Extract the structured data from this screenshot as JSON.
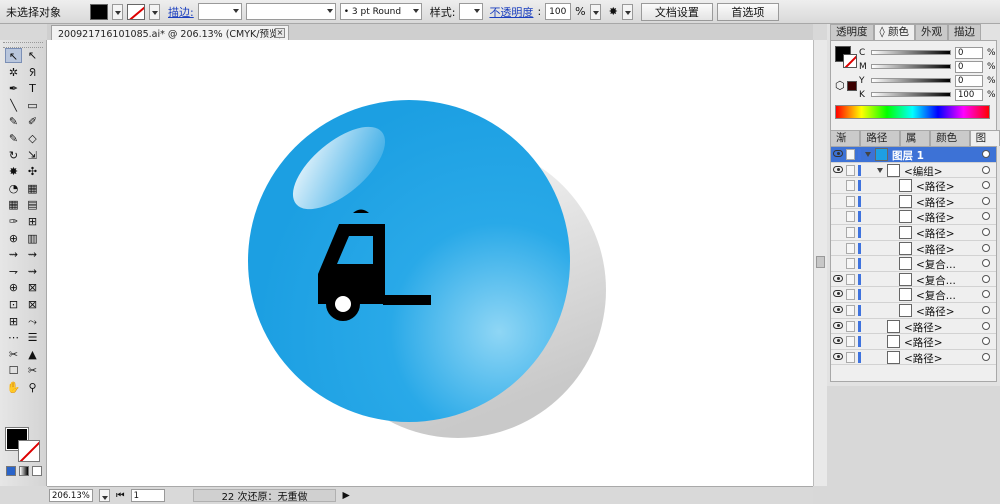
{
  "control_bar": {
    "selection_status": "未选择对象",
    "stroke_link": "描边:",
    "brush_value": "3 pt Round",
    "style_label": "样式:",
    "opacity_link": "不透明度",
    "opacity_value": "100",
    "opacity_unit": "%",
    "doc_setup_button": "文档设置",
    "preferences_button": "首选项"
  },
  "document_tab": {
    "title": "2009217161010​85.ai* @ 206.13% (CMYK/预览)",
    "close_glyph": "×"
  },
  "toolbox": {
    "tool_glyphs": [
      "↖",
      "↖",
      "✲",
      "ᖆ",
      "✒",
      "T",
      "╲",
      "▭",
      "✎",
      "✐",
      "✎",
      "◇",
      "↻",
      "⇲",
      "✸",
      "✣",
      "◔",
      "▦",
      "▦",
      "▤",
      "✑",
      "⊞",
      "⊕",
      "▥",
      "⇝",
      "⇝",
      "⇁",
      "⇝",
      "⊕",
      "⊠",
      "⊡",
      "⊠",
      "⊞",
      "⤳",
      "⋯",
      "☰",
      "✂",
      "▲",
      "☐",
      "✂",
      "✋",
      "⚲"
    ]
  },
  "color_panel": {
    "tabs": [
      "透明度",
      "◊ 颜色",
      "外观",
      "描边"
    ],
    "active_tab": 1,
    "channels": [
      {
        "label": "C",
        "value": "0"
      },
      {
        "label": "M",
        "value": "0"
      },
      {
        "label": "Y",
        "value": "0"
      },
      {
        "label": "K",
        "value": "100"
      }
    ],
    "fill_color": "#000000"
  },
  "layers_panel": {
    "tabs": [
      "渐变",
      "路径查",
      "属性",
      "颜色参",
      "图层"
    ],
    "active_tab": 4,
    "rows": [
      {
        "name": "图层 1",
        "indent": 0,
        "selected": true,
        "eye": true
      },
      {
        "name": "<编组>",
        "indent": 1,
        "selected": false,
        "eye": true
      },
      {
        "name": "<路径>",
        "indent": 2,
        "selected": false,
        "eye": false
      },
      {
        "name": "<路径>",
        "indent": 2,
        "selected": false,
        "eye": false
      },
      {
        "name": "<路径>",
        "indent": 2,
        "selected": false,
        "eye": false
      },
      {
        "name": "<路径>",
        "indent": 2,
        "selected": false,
        "eye": false
      },
      {
        "name": "<路径>",
        "indent": 2,
        "selected": false,
        "eye": false
      },
      {
        "name": "<复合...",
        "indent": 2,
        "selected": false,
        "eye": false
      },
      {
        "name": "<复合...",
        "indent": 2,
        "selected": false,
        "eye": true
      },
      {
        "name": "<复合...",
        "indent": 2,
        "selected": false,
        "eye": true
      },
      {
        "name": "<路径>",
        "indent": 2,
        "selected": false,
        "eye": true
      },
      {
        "name": "<路径>",
        "indent": 1,
        "selected": false,
        "eye": true
      },
      {
        "name": "<路径>",
        "indent": 1,
        "selected": false,
        "eye": true
      },
      {
        "name": "<路径>",
        "indent": 1,
        "selected": false,
        "eye": true
      }
    ]
  },
  "status_bar": {
    "zoom": "206.13%",
    "artboard": "1",
    "undo_status": "22 次还原：无重做"
  },
  "colors": {
    "ball_light": "#8fd6f5",
    "ball_mid": "#29a9e8",
    "ball_dark": "#1c9fe2",
    "shadow": "#e6e6e6",
    "selection_blue": "#3d72d6"
  }
}
